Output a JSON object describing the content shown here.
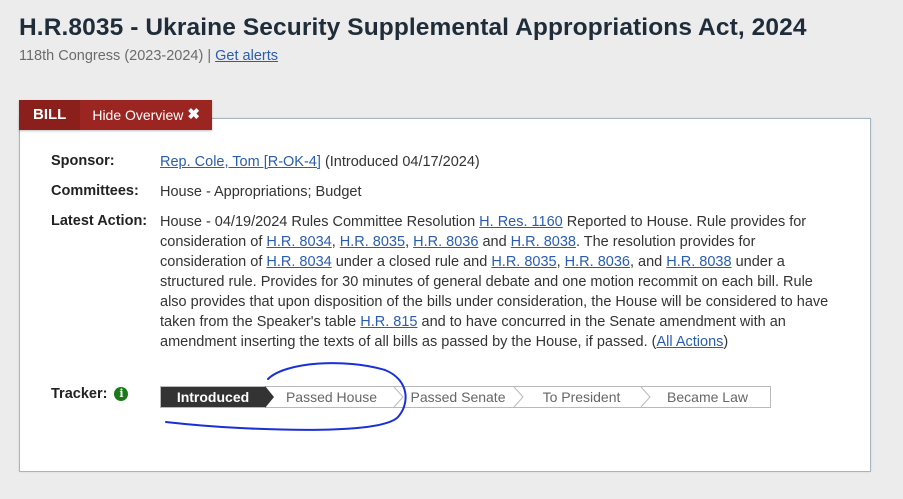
{
  "header": {
    "title": "H.R.8035 - Ukraine Security Supplemental Appropriations Act, 2024",
    "congress": "118th Congress (2023-2024) |",
    "alerts_link": "Get alerts"
  },
  "tabs": {
    "bill": "BILL",
    "hide_overview": "Hide Overview",
    "hide_icon": "✖"
  },
  "overview": {
    "sponsor_label": "Sponsor:",
    "sponsor_link": "Rep. Cole, Tom [R-OK-4]",
    "sponsor_intro": "(Introduced 04/17/2024)",
    "committees_label": "Committees:",
    "committees_value": "House - Appropriations; Budget",
    "latest_action_label": "Latest Action:",
    "latest_action": {
      "t1": "House - 04/19/2024 Rules Committee Resolution ",
      "l1": "H. Res. 1160",
      "t2": " Reported to House. Rule provides for consideration of ",
      "l2": "H.R. 8034",
      "t3": ", ",
      "l3": "H.R. 8035",
      "t4": ", ",
      "l4": "H.R. 8036",
      "t5": " and ",
      "l5": "H.R. 8038",
      "t6": ". The resolution provides for consideration of ",
      "l6": "H.R. 8034",
      "t7": " under a closed rule and ",
      "l7": "H.R. 8035",
      "t8": ", ",
      "l8": "H.R. 8036",
      "t9": ", and ",
      "l9": "H.R. 8038",
      "t10": " under a structured rule. Provides for 30 minutes of general debate and one motion recommit on each bill. Rule also provides that upon disposition of the bills under consideration, the House will be considered to have taken from the Speaker's table ",
      "l10": "H.R. 815",
      "t11": " and to have concurred in the Senate amendment with an amendment inserting the texts of all bills as passed by the House, if passed.  (",
      "l11": "All Actions",
      "t12": ")"
    },
    "tracker_label": "Tracker:",
    "tracker_info_icon": "i",
    "tracker_steps": [
      "Introduced",
      "Passed House",
      "Passed Senate",
      "To President",
      "Became Law"
    ],
    "tracker_current_index": 0
  },
  "colors": {
    "tab_red": "#9b2521",
    "link_blue": "#2a5db0",
    "tracker_active": "#333333",
    "annotation_ink": "#1a2fd6"
  }
}
